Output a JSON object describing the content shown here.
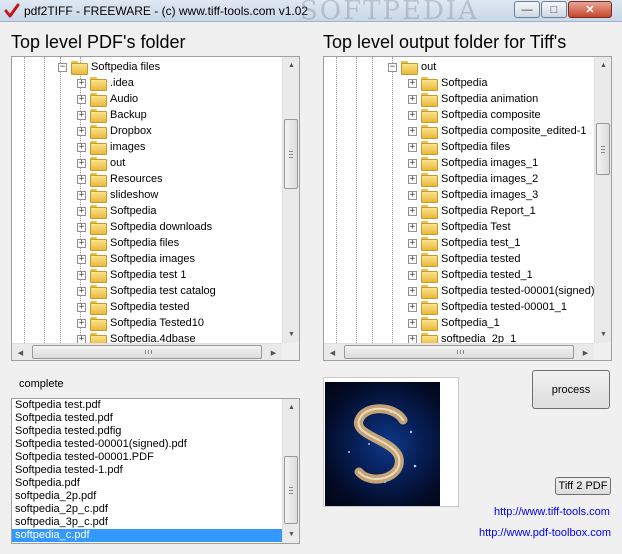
{
  "window": {
    "title": "pdf2TIFF - FREEWARE - (c) www.tiff-tools.com v1.02",
    "watermark": "SOFTPEDIA",
    "buttons": {
      "minimize": "—",
      "maximize": "□",
      "close": "✕"
    }
  },
  "left_panel": {
    "heading": "Top level PDF's folder",
    "root": "Softpedia files",
    "folders": [
      ".idea",
      "Audio",
      "Backup",
      "Dropbox",
      "images",
      "out",
      "Resources",
      "slideshow",
      "Softpedia",
      "Softpedia downloads",
      "Softpedia files",
      "Softpedia images",
      "Softpedia test 1",
      "Softpedia test catalog",
      "Softpedia tested",
      "Softpedia Tested10",
      "Softpedia.4dbase"
    ]
  },
  "right_panel": {
    "heading": "Top level output folder for Tiff's",
    "root": "out",
    "folders": [
      "Softpedia",
      "Softpedia animation",
      "Softpedia composite",
      "Softpedia composite_edited-1",
      "Softpedia files",
      "Softpedia images_1",
      "Softpedia images_2",
      "Softpedia images_3",
      "Softpedia Report_1",
      "Softpedia Test",
      "Softpedia test_1",
      "Softpedia tested",
      "Softpedia tested_1",
      "Softpedia tested-00001(signed)",
      "Softpedia tested-00001_1",
      "Softpedia_1",
      "softpedia_2p_1"
    ]
  },
  "status": "complete",
  "files": [
    "Softpedia test.pdf",
    "Softpedia tested.pdf",
    "Softpedia tested.pdfig",
    "Softpedia tested-00001(signed).pdf",
    "Softpedia tested-00001.PDF",
    "Softpedia tested-1.pdf",
    "Softpedia.pdf",
    "softpedia_2p.pdf",
    "softpedia_2p_c.pdf",
    "softpedia_3p_c.pdf",
    "softpedia_c.pdf"
  ],
  "selected_file": "softpedia_c.pdf",
  "actions": {
    "process": "process",
    "tiff2pdf": "Tiff 2 PDF"
  },
  "links": {
    "tiff_tools": "http://www.tiff-tools.com",
    "pdf_toolbox": "http://www.pdf-toolbox.com"
  },
  "colors": {
    "selection": "#3399ff",
    "link": "#0000ee",
    "folder": "#f2cd5c"
  },
  "icons": {
    "app": "checkmark-icon",
    "folder": "folder-icon",
    "expand": "plus-expander-icon"
  }
}
